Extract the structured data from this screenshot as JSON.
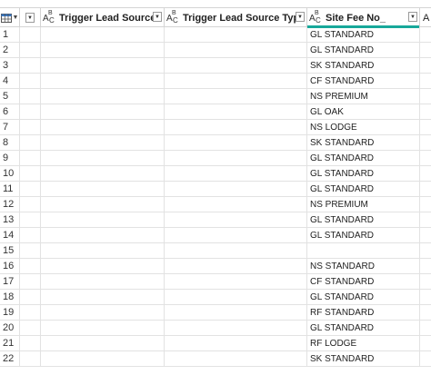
{
  "columns": {
    "b": {
      "type_icon": "text-type-icon",
      "label": "Trigger Lead Source"
    },
    "c": {
      "type_icon": "text-type-icon",
      "label": "Trigger Lead Source Type"
    },
    "d": {
      "type_icon": "text-type-icon",
      "label": "Site Fee No_"
    },
    "e": {
      "label": "A"
    }
  },
  "type_icon_text": {
    "a": "A",
    "b": "B",
    "c": "C"
  },
  "rows": [
    {
      "n": "1",
      "site_fee": "GL STANDARD"
    },
    {
      "n": "2",
      "site_fee": "GL STANDARD"
    },
    {
      "n": "3",
      "site_fee": "SK STANDARD"
    },
    {
      "n": "4",
      "site_fee": "CF STANDARD"
    },
    {
      "n": "5",
      "site_fee": "NS PREMIUM"
    },
    {
      "n": "6",
      "site_fee": "GL OAK"
    },
    {
      "n": "7",
      "site_fee": "NS LODGE"
    },
    {
      "n": "8",
      "site_fee": "SK STANDARD"
    },
    {
      "n": "9",
      "site_fee": "GL STANDARD"
    },
    {
      "n": "10",
      "site_fee": "GL STANDARD"
    },
    {
      "n": "11",
      "site_fee": "GL STANDARD"
    },
    {
      "n": "12",
      "site_fee": "NS PREMIUM"
    },
    {
      "n": "13",
      "site_fee": "GL STANDARD"
    },
    {
      "n": "14",
      "site_fee": "GL STANDARD"
    },
    {
      "n": "15",
      "site_fee": ""
    },
    {
      "n": "16",
      "site_fee": "NS STANDARD"
    },
    {
      "n": "17",
      "site_fee": "CF STANDARD"
    },
    {
      "n": "18",
      "site_fee": "GL STANDARD"
    },
    {
      "n": "19",
      "site_fee": "RF STANDARD"
    },
    {
      "n": "20",
      "site_fee": "GL STANDARD"
    },
    {
      "n": "21",
      "site_fee": "RF LODGE"
    },
    {
      "n": "22",
      "site_fee": "SK STANDARD"
    }
  ]
}
